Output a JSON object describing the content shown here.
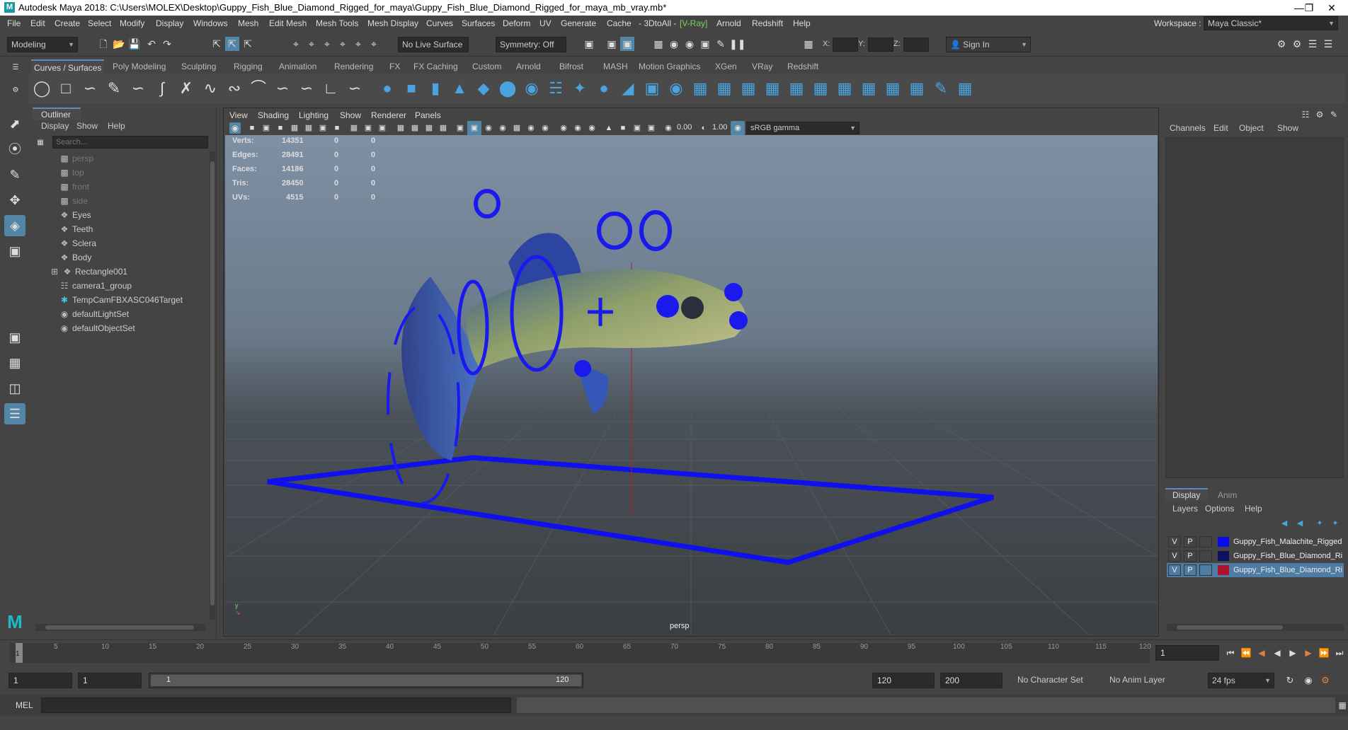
{
  "window": {
    "title": "Autodesk Maya 2018: C:\\Users\\MOLEX\\Desktop\\Guppy_Fish_Blue_Diamond_Rigged_for_maya\\Guppy_Fish_Blue_Diamond_Rigged_for_maya_mb_vray.mb*",
    "logo": "M",
    "minimize_icon": "minimize-icon",
    "restore_icon": "restore-icon",
    "close_icon": "close-icon"
  },
  "menubar": {
    "items": [
      "File",
      "Edit",
      "Create",
      "Select",
      "Modify",
      "Display",
      "Windows",
      "Mesh",
      "Edit Mesh",
      "Mesh Tools",
      "Mesh Display",
      "Curves",
      "Surfaces",
      "Deform",
      "UV",
      "Generate",
      "Cache",
      "- 3DtoAll -",
      "V-Ray",
      "Arnold",
      "Redshift",
      "Help"
    ],
    "workspace_label": "Workspace :",
    "workspace_value": "Maya Classic*"
  },
  "statusline": {
    "menuset": "Modeling",
    "live_surface": "No Live Surface",
    "symmetry": "Symmetry: Off",
    "x_label": "X:",
    "y_label": "Y:",
    "z_label": "Z:",
    "sign_in": "Sign In"
  },
  "shelf": {
    "tabs": [
      "Curves / Surfaces",
      "Poly Modeling",
      "Sculpting",
      "Rigging",
      "Animation",
      "Rendering",
      "FX",
      "FX Caching",
      "Custom",
      "Arnold",
      "Bifrost",
      "MASH",
      "Motion Graphics",
      "XGen",
      "VRay",
      "Redshift"
    ],
    "active_tab": 0
  },
  "outliner": {
    "title": "Outliner",
    "menus": [
      "Display",
      "Show",
      "Help"
    ],
    "search_placeholder": "Search...",
    "items": [
      {
        "label": "persp",
        "dim": true,
        "icon": "camera-icon"
      },
      {
        "label": "top",
        "dim": true,
        "icon": "camera-icon"
      },
      {
        "label": "front",
        "dim": true,
        "icon": "camera-icon"
      },
      {
        "label": "side",
        "dim": true,
        "icon": "camera-icon"
      },
      {
        "label": "Eyes",
        "dim": false,
        "icon": "mesh-icon"
      },
      {
        "label": "Teeth",
        "dim": false,
        "icon": "mesh-icon"
      },
      {
        "label": "Sclera",
        "dim": false,
        "icon": "mesh-icon"
      },
      {
        "label": "Body",
        "dim": false,
        "icon": "mesh-icon"
      },
      {
        "label": "Rectangle001",
        "dim": false,
        "icon": "group-icon"
      },
      {
        "label": "camera1_group",
        "dim": false,
        "icon": "group-icon"
      },
      {
        "label": "TempCamFBXASC046Target",
        "dim": false,
        "icon": "locator-icon"
      },
      {
        "label": "defaultLightSet",
        "dim": false,
        "icon": "set-icon"
      },
      {
        "label": "defaultObjectSet",
        "dim": false,
        "icon": "set-icon"
      }
    ]
  },
  "viewport": {
    "menus": [
      "View",
      "Shading",
      "Lighting",
      "Show",
      "Renderer",
      "Panels"
    ],
    "exposure": "0.00",
    "gamma": "1.00",
    "color_space": "sRGB gamma",
    "camera": "persp",
    "hud": [
      {
        "label": "Verts:",
        "a": "14351",
        "b": "0",
        "c": "0"
      },
      {
        "label": "Edges:",
        "a": "28491",
        "b": "0",
        "c": "0"
      },
      {
        "label": "Faces:",
        "a": "14186",
        "b": "0",
        "c": "0"
      },
      {
        "label": "Tris:",
        "a": "28450",
        "b": "0",
        "c": "0"
      },
      {
        "label": "UVs:",
        "a": "4515",
        "b": "0",
        "c": "0"
      }
    ]
  },
  "channel_box": {
    "menus": [
      "Channels",
      "Edit",
      "Object",
      "Show"
    ]
  },
  "layer_editor": {
    "tabs": [
      "Display",
      "Anim"
    ],
    "menus": [
      "Layers",
      "Options",
      "Help"
    ],
    "layers": [
      {
        "v": "V",
        "p": "P",
        "color": "#0a0aee",
        "name": "Guppy_Fish_Malachite_Rigged",
        "selected": false
      },
      {
        "v": "V",
        "p": "P",
        "color": "#101060",
        "name": "Guppy_Fish_Blue_Diamond_Ri",
        "selected": false
      },
      {
        "v": "V",
        "p": "P",
        "color": "#b01030",
        "name": "Guppy_Fish_Blue_Diamond_Ri",
        "selected": true
      }
    ]
  },
  "timeslider": {
    "ticks": [
      "5",
      "10",
      "15",
      "20",
      "25",
      "30",
      "35",
      "40",
      "45",
      "50",
      "55",
      "60",
      "65",
      "70",
      "75",
      "80",
      "85",
      "90",
      "95",
      "100",
      "105",
      "110",
      "115",
      "120"
    ],
    "start_marker": "1",
    "current_frame": "1"
  },
  "rangeslider": {
    "start": "1",
    "playback_start": "1",
    "range_start": "1",
    "range_end": "120",
    "playback_end": "120",
    "end": "200",
    "character_set": "No Character Set",
    "anim_layer": "No Anim Layer",
    "fps": "24 fps"
  },
  "cmdline": {
    "label": "MEL"
  }
}
